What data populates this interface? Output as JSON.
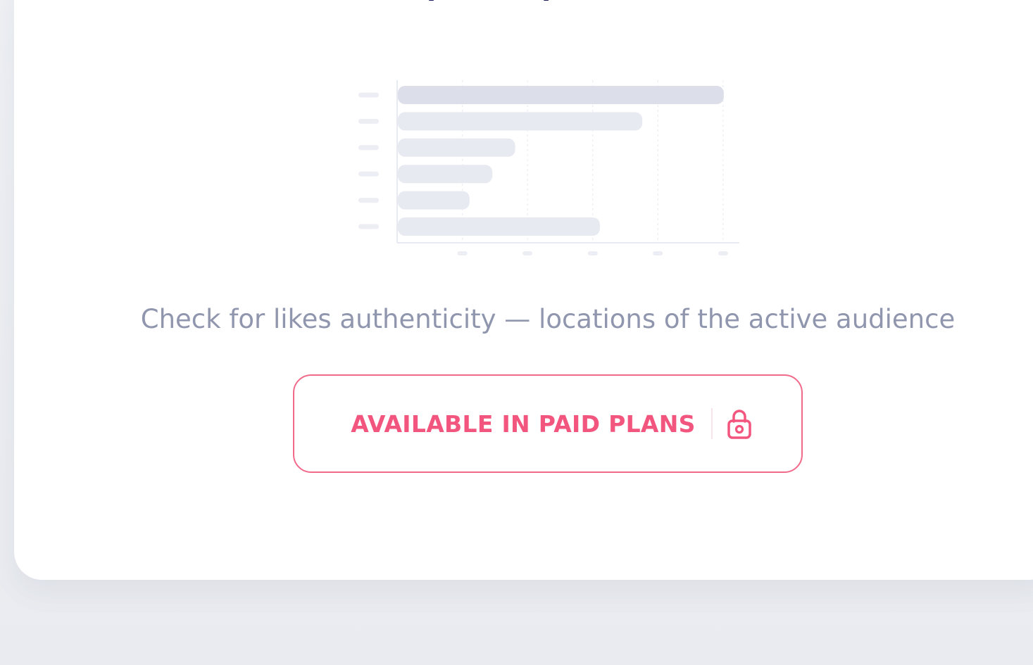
{
  "card": {
    "title": "Audience Location (Likers)",
    "description": "Check for likes authenticity — locations of the active audience",
    "paid_button_label": "AVAILABLE IN PAID PLANS"
  },
  "icons": {
    "lock": "lock-icon"
  },
  "colors": {
    "title": "#1a1a5e",
    "description": "#9096ad",
    "accent": "#f2557d",
    "placeholder_bar_primary": "#dcdfea",
    "placeholder_bar_secondary": "#e8eaf1"
  },
  "chart_data": {
    "type": "bar",
    "orientation": "horizontal",
    "placeholder": true,
    "categories": [
      "",
      "",
      "",
      "",
      "",
      ""
    ],
    "values": [
      100,
      75,
      36,
      29,
      22,
      62
    ],
    "xlim": [
      0,
      105
    ],
    "grid": true
  }
}
